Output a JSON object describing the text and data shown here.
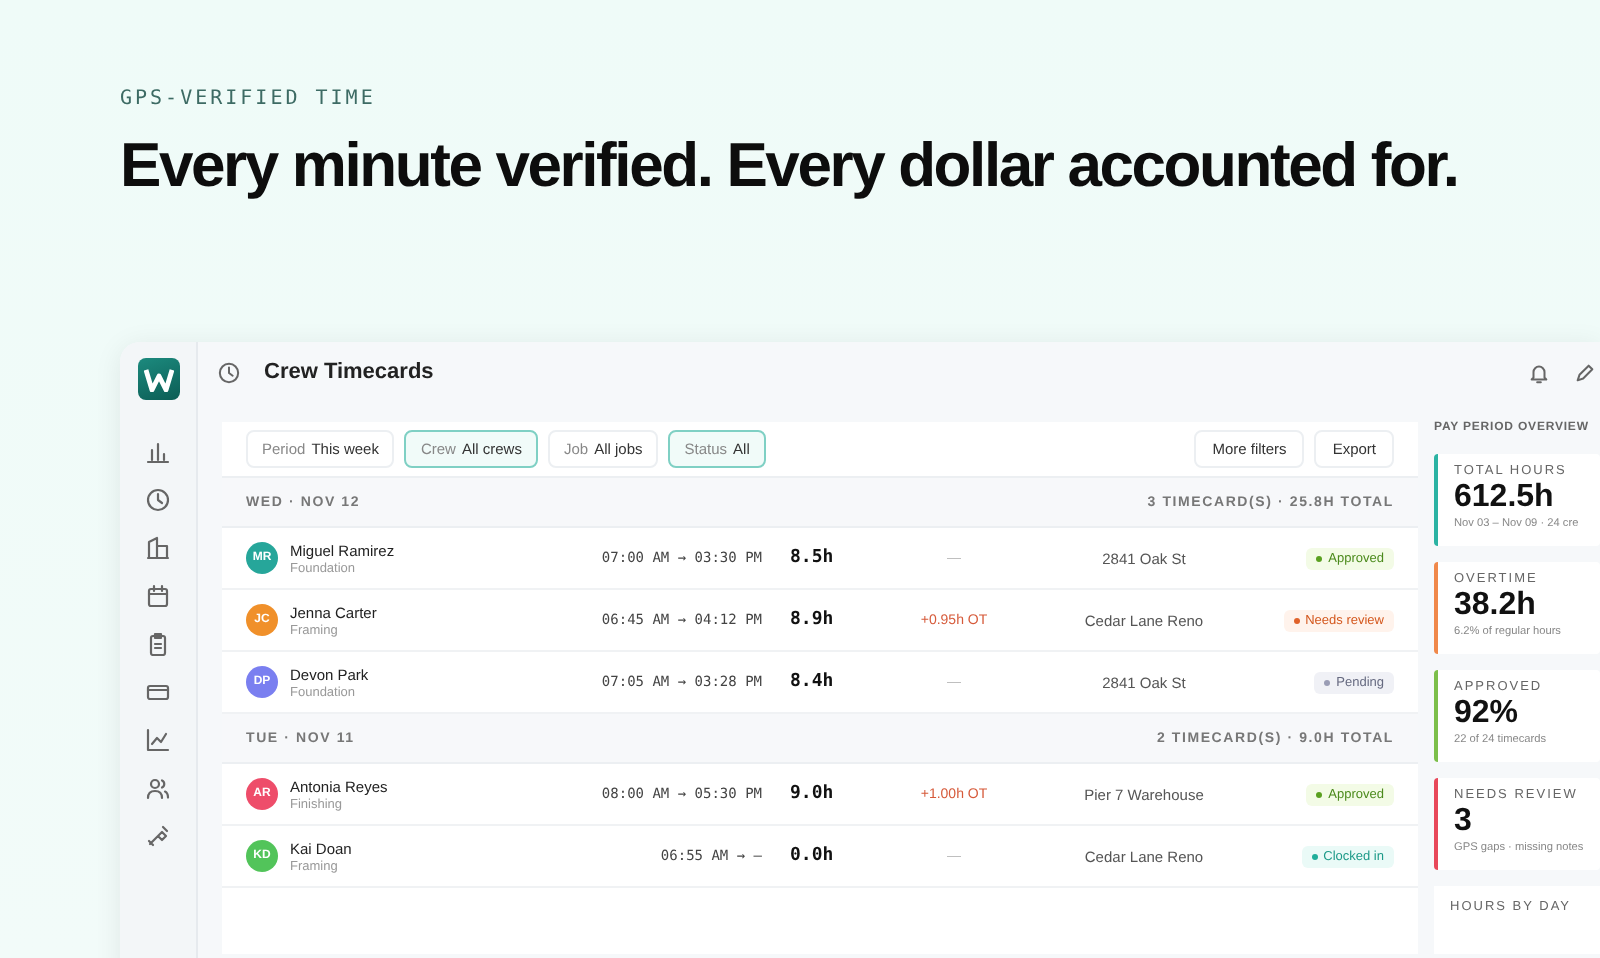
{
  "hero": {
    "eyebrow": "GPS-VERIFIED TIME",
    "headline": "Every minute verified. Every dollar accounted for."
  },
  "app": {
    "title": "Crew Timecards",
    "filters": [
      {
        "name": "Period",
        "value": "This week",
        "active": false
      },
      {
        "name": "Crew",
        "value": "All crews",
        "active": true
      },
      {
        "name": "Job",
        "value": "All jobs",
        "active": false
      },
      {
        "name": "Status",
        "value": "All",
        "active": true
      }
    ],
    "actions": [
      "More filters",
      "Export"
    ],
    "groups": [
      {
        "day": "WED · NOV 12",
        "summary": "3 TIMECARD(S) · 25.8H TOTAL",
        "rows": [
          {
            "initials": "MR",
            "color": "#26a69a",
            "name": "Miguel Ramirez",
            "trade": "Foundation",
            "time": "07:00 AM → 03:30 PM",
            "hours": "8.5h",
            "ot": "—",
            "overtime": false,
            "location": "2841 Oak St",
            "status": "Approved",
            "kind": "approved"
          },
          {
            "initials": "JC",
            "color": "#f0902a",
            "name": "Jenna Carter",
            "trade": "Framing",
            "time": "06:45 AM → 04:12 PM",
            "hours": "8.9h",
            "ot": "+0.95h OT",
            "overtime": true,
            "location": "Cedar Lane Reno",
            "status": "Needs review",
            "kind": "review"
          },
          {
            "initials": "DP",
            "color": "#7a7ff0",
            "name": "Devon Park",
            "trade": "Foundation",
            "time": "07:05 AM → 03:28 PM",
            "hours": "8.4h",
            "ot": "—",
            "overtime": false,
            "location": "2841 Oak St",
            "status": "Pending",
            "kind": "pending"
          }
        ]
      },
      {
        "day": "TUE · NOV 11",
        "summary": "2 TIMECARD(S) · 9.0H TOTAL",
        "rows": [
          {
            "initials": "AR",
            "color": "#ee4d6a",
            "name": "Antonia Reyes",
            "trade": "Finishing",
            "time": "08:00 AM → 05:30 PM",
            "hours": "9.0h",
            "ot": "+1.00h OT",
            "overtime": true,
            "location": "Pier 7 Warehouse",
            "status": "Approved",
            "kind": "approved"
          },
          {
            "initials": "KD",
            "color": "#52c45a",
            "name": "Kai Doan",
            "trade": "Framing",
            "time": "06:55 AM → —",
            "hours": "0.0h",
            "ot": "—",
            "overtime": false,
            "location": "Cedar Lane Reno",
            "status": "Clocked in",
            "kind": "clocked"
          }
        ]
      }
    ],
    "overview": {
      "title": "PAY PERIOD OVERVIEW",
      "cards": [
        {
          "label": "TOTAL HOURS",
          "value": "612.5h",
          "note": "Nov 03 – Nov 09 · 24 cre",
          "color": "#2bb3a3"
        },
        {
          "label": "OVERTIME",
          "value": "38.2h",
          "note": "6.2% of regular hours",
          "color": "#f0884a"
        },
        {
          "label": "APPROVED",
          "value": "92%",
          "note": "22 of 24 timecards",
          "color": "#7cbf4a"
        },
        {
          "label": "NEEDS REVIEW",
          "value": "3",
          "note": "GPS gaps · missing notes",
          "color": "#e8485a"
        }
      ],
      "section": "HOURS BY DAY"
    }
  }
}
